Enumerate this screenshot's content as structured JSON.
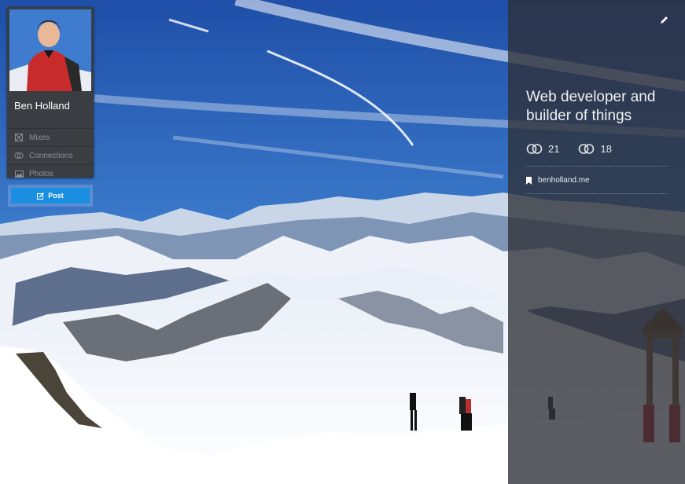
{
  "profile": {
    "name": "Ben Holland",
    "menu": [
      {
        "label": "Mixes",
        "icon": "mixes-icon"
      },
      {
        "label": "Connections",
        "icon": "connections-icon"
      },
      {
        "label": "Photos",
        "icon": "photos-icon"
      }
    ]
  },
  "post_button": {
    "label": "Post",
    "icon": "compose-icon"
  },
  "panel": {
    "headline": "Web developer and builder of things",
    "stats": [
      {
        "value": "21",
        "icon": "connections-icon"
      },
      {
        "value": "18",
        "icon": "connections-icon"
      }
    ],
    "website": {
      "label": "benholland.me",
      "icon": "bookmark-icon"
    },
    "edit_icon": "pencil-icon"
  },
  "colors": {
    "accent": "#1a8ee0",
    "card_bg": "#3a3d42",
    "panel_bg": "#2e3036"
  }
}
